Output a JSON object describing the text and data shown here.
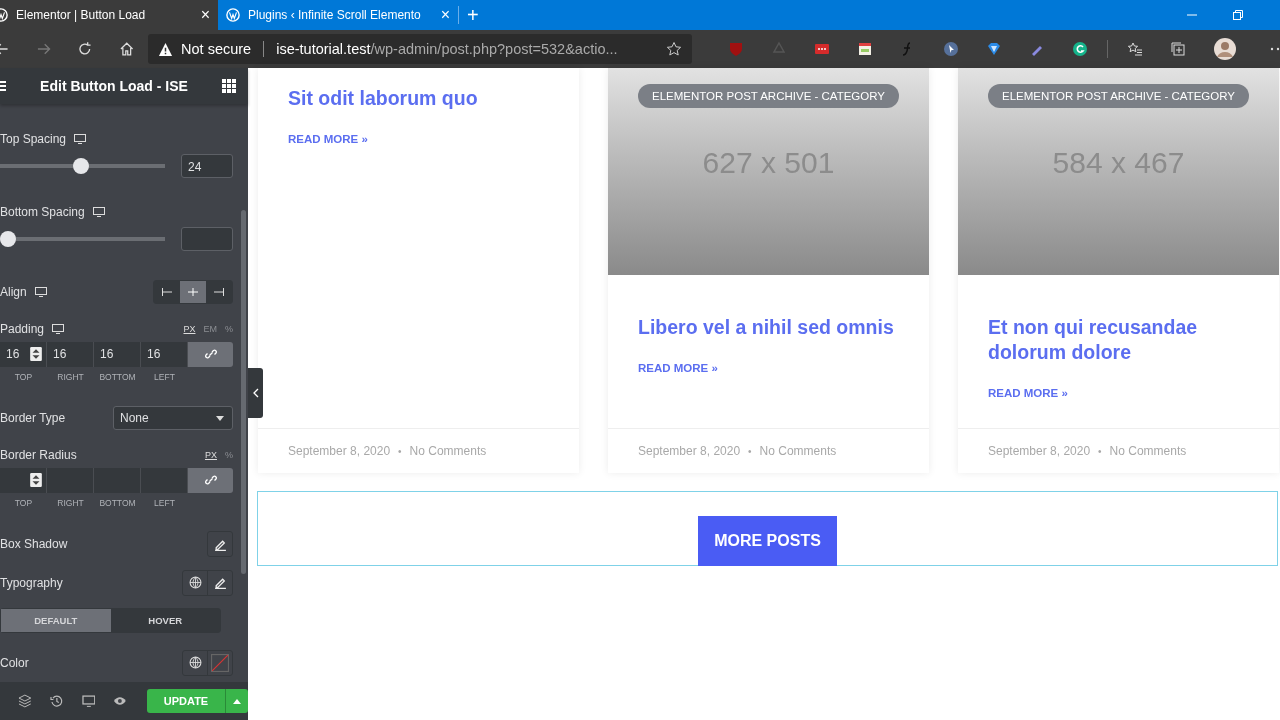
{
  "browser": {
    "tabs": [
      {
        "title": "Elementor | Button Load",
        "selected": true,
        "close": "×"
      },
      {
        "title": "Plugins ‹ Infinite Scroll Elemento",
        "selected": false,
        "close": "×"
      }
    ],
    "new_tab": "+",
    "address": {
      "security": "Not secure",
      "host": "ise-tutorial.test",
      "path": "/wp-admin/post.php?post=532&actio..."
    }
  },
  "editor": {
    "title": "Edit Button Load - ISE",
    "controls": [
      {
        "kind": "slider",
        "label": "Top Spacing",
        "level": 0.49,
        "value": "24"
      },
      {
        "kind": "slider",
        "label": "Bottom Spacing",
        "level": 0
      },
      {
        "kind": "align",
        "label": "Align",
        "options": [
          {
            "kind": "left",
            "selected": false
          },
          {
            "kind": "center",
            "selected": true
          },
          {
            "kind": "right",
            "selected": false
          }
        ]
      },
      {
        "kind": "dimensions",
        "label": "Padding",
        "units": [
          {
            "label": "PX",
            "selected": true
          },
          {
            "label": "EM",
            "selected": false
          },
          {
            "label": "%",
            "selected": false
          }
        ],
        "values": [
          "16",
          "16",
          "16",
          "16"
        ],
        "sides": [
          "TOP",
          "RIGHT",
          "BOTTOM",
          "LEFT"
        ],
        "linked": true
      },
      {
        "kind": "select",
        "label": "Border Type",
        "value": "None"
      },
      {
        "kind": "dimensions",
        "label": "Border Radius",
        "units": [
          {
            "label": "PX",
            "selected": true
          },
          {
            "label": "%",
            "selected": false
          }
        ],
        "sides": [
          "TOP",
          "RIGHT",
          "BOTTOM",
          "LEFT"
        ],
        "linked": true
      },
      {
        "kind": "popover",
        "label": "Box Shadow",
        "global": false
      },
      {
        "kind": "popover",
        "label": "Typography",
        "global": true
      },
      {
        "kind": "tabs",
        "tabs": [
          {
            "label": "DEFAULT",
            "selected": true
          },
          {
            "label": "HOVER",
            "selected": false
          }
        ]
      },
      {
        "kind": "color",
        "label": "Color"
      }
    ],
    "update": "UPDATE"
  },
  "posts": [
    {
      "title": "Sit odit laborum quo",
      "read_more": "READ MORE »",
      "date": "September 8, 2020",
      "separator": "•",
      "comments": "No Comments"
    },
    {
      "badge": "ELEMENTOR POST ARCHIVE - CATEGORY",
      "image_size": "627 x 501",
      "title": "Libero vel a nihil sed omnis",
      "read_more": "READ MORE »",
      "date": "September 8, 2020",
      "separator": "•",
      "comments": "No Comments"
    },
    {
      "badge": "ELEMENTOR POST ARCHIVE - CATEGORY",
      "image_size": "584 x 467",
      "title": "Et non qui recusandae dolorum dolore",
      "read_more": "READ MORE »",
      "date": "September 8, 2020",
      "separator": "•",
      "comments": "No Comments"
    }
  ],
  "more_button": "MORE POSTS"
}
